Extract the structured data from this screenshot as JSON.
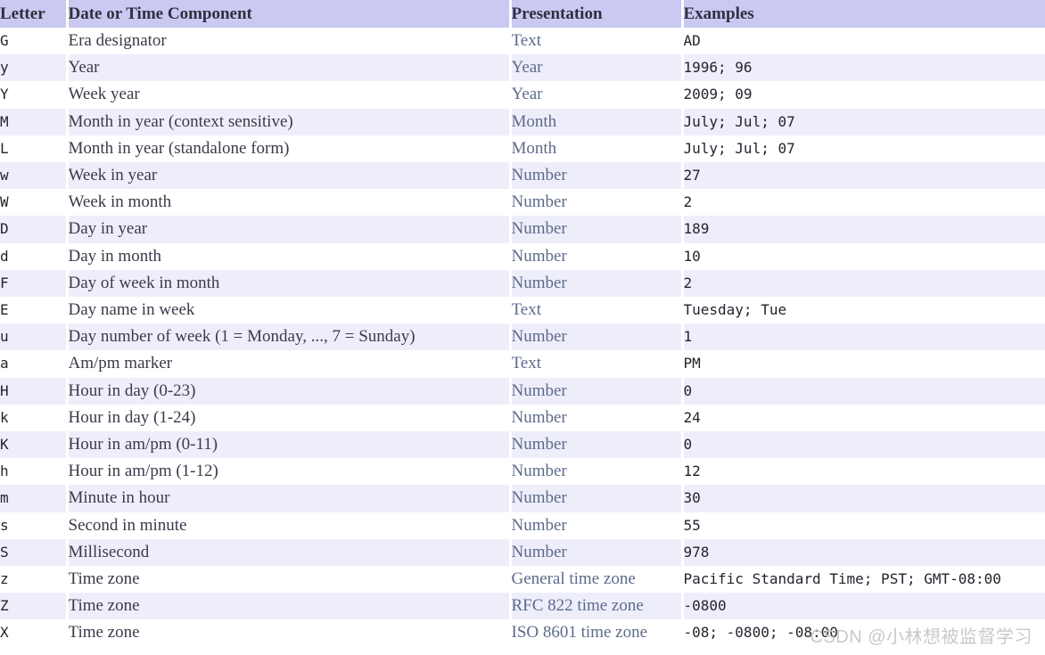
{
  "table": {
    "columns": [
      {
        "key": "letter",
        "label": "Letter"
      },
      {
        "key": "component",
        "label": "Date or Time Component"
      },
      {
        "key": "presentation",
        "label": "Presentation"
      },
      {
        "key": "examples",
        "label": "Examples"
      }
    ],
    "rows": [
      {
        "letter": "G",
        "component": "Era designator",
        "presentation": "Text",
        "examples": "AD"
      },
      {
        "letter": "y",
        "component": "Year",
        "presentation": "Year",
        "examples": "1996; 96"
      },
      {
        "letter": "Y",
        "component": "Week year",
        "presentation": "Year",
        "examples": "2009; 09"
      },
      {
        "letter": "M",
        "component": "Month in year (context sensitive)",
        "presentation": "Month",
        "examples": "July; Jul; 07"
      },
      {
        "letter": "L",
        "component": "Month in year (standalone form)",
        "presentation": "Month",
        "examples": "July; Jul; 07"
      },
      {
        "letter": "w",
        "component": "Week in year",
        "presentation": "Number",
        "examples": "27"
      },
      {
        "letter": "W",
        "component": "Week in month",
        "presentation": "Number",
        "examples": "2"
      },
      {
        "letter": "D",
        "component": "Day in year",
        "presentation": "Number",
        "examples": "189"
      },
      {
        "letter": "d",
        "component": "Day in month",
        "presentation": "Number",
        "examples": "10"
      },
      {
        "letter": "F",
        "component": "Day of week in month",
        "presentation": "Number",
        "examples": "2"
      },
      {
        "letter": "E",
        "component": "Day name in week",
        "presentation": "Text",
        "examples": "Tuesday; Tue"
      },
      {
        "letter": "u",
        "component": "Day number of week (1 = Monday, ..., 7 = Sunday)",
        "presentation": "Number",
        "examples": "1"
      },
      {
        "letter": "a",
        "component": "Am/pm marker",
        "presentation": "Text",
        "examples": "PM"
      },
      {
        "letter": "H",
        "component": "Hour in day (0-23)",
        "presentation": "Number",
        "examples": "0"
      },
      {
        "letter": "k",
        "component": "Hour in day (1-24)",
        "presentation": "Number",
        "examples": "24"
      },
      {
        "letter": "K",
        "component": "Hour in am/pm (0-11)",
        "presentation": "Number",
        "examples": "0"
      },
      {
        "letter": "h",
        "component": "Hour in am/pm (1-12)",
        "presentation": "Number",
        "examples": "12"
      },
      {
        "letter": "m",
        "component": "Minute in hour",
        "presentation": "Number",
        "examples": "30"
      },
      {
        "letter": "s",
        "component": "Second in minute",
        "presentation": "Number",
        "examples": "55"
      },
      {
        "letter": "S",
        "component": "Millisecond",
        "presentation": "Number",
        "examples": "978"
      },
      {
        "letter": "z",
        "component": "Time zone",
        "presentation": "General time zone",
        "examples": "Pacific Standard Time; PST; GMT-08:00"
      },
      {
        "letter": "Z",
        "component": "Time zone",
        "presentation": "RFC 822 time zone",
        "examples": "-0800"
      },
      {
        "letter": "X",
        "component": "Time zone",
        "presentation": "ISO 8601 time zone",
        "examples": "-08; -0800; -08:00"
      }
    ]
  },
  "watermark": {
    "text": "CSDN @小林想被监督学习"
  },
  "colors": {
    "header_background": "#c9c9f2",
    "row_stripe_background": "#eeeefb",
    "row_plain_background": "#ffffff",
    "presentation_text": "#5c6b8a",
    "body_text": "#3a3a4a",
    "watermark_text": "#c9c9c9"
  }
}
